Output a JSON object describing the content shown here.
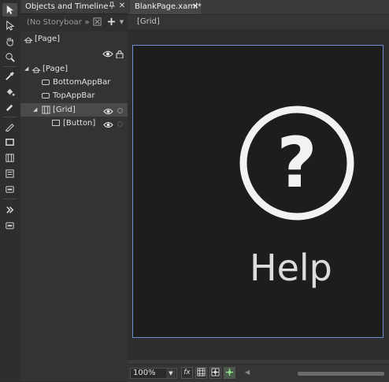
{
  "objects_panel": {
    "tab_label": "Objects and Timeline",
    "storyboard_placeholder": "(No Storyboar",
    "page_root_label": "[Page]",
    "tree": [
      {
        "label": "[Page]"
      },
      {
        "label": "BottomAppBar"
      },
      {
        "label": "TopAppBar"
      },
      {
        "label": "[Grid]",
        "selected": true
      },
      {
        "label": "[Button]"
      }
    ]
  },
  "document": {
    "tab_label": "BlankPage.xaml*",
    "breadcrumb": "[Grid]",
    "help_symbol": "?",
    "help_label": "Help",
    "zoom": "100%",
    "fx_label": "fx"
  },
  "colors": {
    "artboard_border": "#6f8ed6",
    "artboard_bg": "#1d1d1d",
    "panel_bg": "#333333"
  }
}
